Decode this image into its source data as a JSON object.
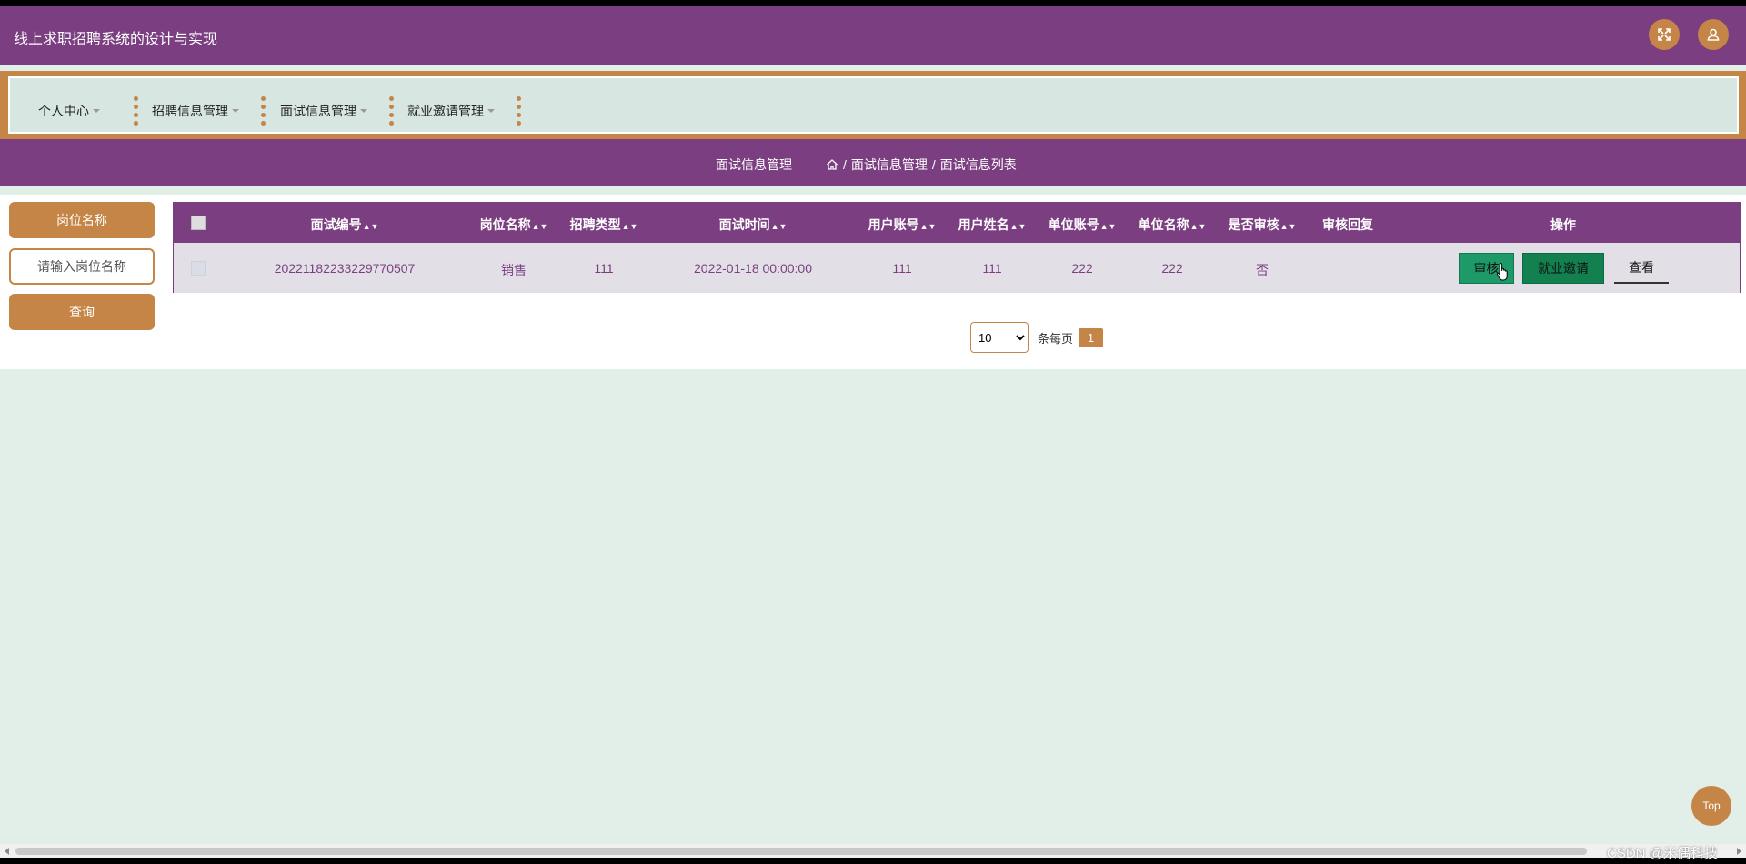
{
  "app": {
    "title": "线上求职招聘系统的设计与实现"
  },
  "topbar": {
    "fullscreen_icon": "fullscreen-icon",
    "user_icon": "user-icon",
    "accent": "#c58547",
    "brand": "#7b3f81"
  },
  "nav": {
    "items": [
      {
        "label": "个人中心"
      },
      {
        "label": "招聘信息管理"
      },
      {
        "label": "面试信息管理"
      },
      {
        "label": "就业邀请管理"
      }
    ]
  },
  "breadcrumb": {
    "title": "面试信息管理",
    "items": [
      "面试信息管理",
      "面试信息列表"
    ],
    "separator": "/"
  },
  "search": {
    "label": "岗位名称",
    "placeholder": "请输入岗位名称",
    "button": "查询"
  },
  "table": {
    "columns": [
      {
        "label": "面试编号",
        "sortable": true
      },
      {
        "label": "岗位名称",
        "sortable": true
      },
      {
        "label": "招聘类型",
        "sortable": true
      },
      {
        "label": "面试时间",
        "sortable": true
      },
      {
        "label": "用户账号",
        "sortable": true
      },
      {
        "label": "用户姓名",
        "sortable": true
      },
      {
        "label": "单位账号",
        "sortable": true
      },
      {
        "label": "单位名称",
        "sortable": true
      },
      {
        "label": "是否审核",
        "sortable": true
      },
      {
        "label": "审核回复",
        "sortable": false
      },
      {
        "label": "操作",
        "sortable": false
      }
    ],
    "rows": [
      {
        "cells": [
          "20221182233229770507",
          "销售",
          "111",
          "2022-01-18 00:00:00",
          "111",
          "111",
          "222",
          "222",
          "否",
          ""
        ],
        "actions": [
          "审核",
          "就业邀请",
          "查看"
        ]
      }
    ]
  },
  "pagination": {
    "page_size": "10",
    "page_size_options": [
      "10"
    ],
    "per_page_label": "条每页",
    "current_page": "1"
  },
  "back_to_top": "Top",
  "watermark": "CSDN @米偶科技"
}
